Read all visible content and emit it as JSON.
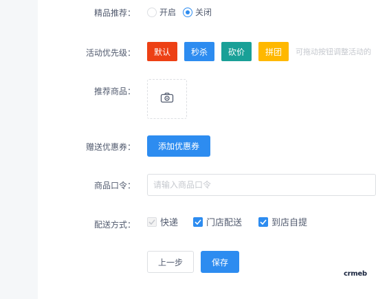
{
  "form": {
    "featured": {
      "label": "精品推荐：",
      "options": [
        "开启",
        "关闭"
      ],
      "selected": "关闭"
    },
    "priority": {
      "label": "活动优先级：",
      "buttons": [
        {
          "label": "默认",
          "color": "#ed4014"
        },
        {
          "label": "秒杀",
          "color": "#2d8cf0"
        },
        {
          "label": "砍价",
          "color": "#19a097"
        },
        {
          "label": "拼团",
          "color": "#ffb800"
        }
      ],
      "hint": "可拖动按钮调整活动的"
    },
    "recommend_goods": {
      "label": "推荐商品：",
      "upload_icon": "camera-icon"
    },
    "coupon": {
      "label": "赠送优惠券：",
      "button_label": "添加优惠券"
    },
    "password": {
      "label": "商品口令：",
      "placeholder": "请输入商品口令",
      "value": ""
    },
    "delivery": {
      "label": "配送方式：",
      "options": [
        {
          "label": "快递",
          "checked": true,
          "disabled": true
        },
        {
          "label": "门店配送",
          "checked": true,
          "disabled": false
        },
        {
          "label": "到店自提",
          "checked": true,
          "disabled": false
        }
      ]
    }
  },
  "footer": {
    "prev_label": "上一步",
    "save_label": "保存"
  },
  "brand": {
    "logo_text": "crmeb"
  }
}
